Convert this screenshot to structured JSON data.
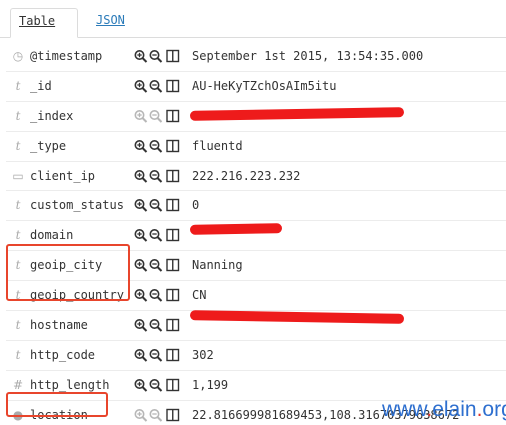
{
  "tabs": {
    "table_label": "Table",
    "json_label": "JSON"
  },
  "rows": [
    {
      "type_icon": "clock-icon",
      "type_glyph": "◷",
      "field": "@timestamp",
      "value": "September 1st 2015, 13:54:35.000"
    },
    {
      "type_icon": "string-type-icon",
      "type_glyph": "t",
      "field": "_id",
      "value": "AU-HeKyTZchOsAIm5itu"
    },
    {
      "type_icon": "string-type-icon",
      "type_glyph": "t",
      "field": "_index",
      "value": ""
    },
    {
      "type_icon": "string-type-icon",
      "type_glyph": "t",
      "field": "_type",
      "value": "fluentd"
    },
    {
      "type_icon": "ip-type-icon",
      "type_glyph": "▭",
      "field": "client_ip",
      "value": "222.216.223.232"
    },
    {
      "type_icon": "string-type-icon",
      "type_glyph": "t",
      "field": "custom_status",
      "value": "0"
    },
    {
      "type_icon": "string-type-icon",
      "type_glyph": "t",
      "field": "domain",
      "value": ""
    },
    {
      "type_icon": "string-type-icon",
      "type_glyph": "t",
      "field": "geoip_city",
      "value": "Nanning"
    },
    {
      "type_icon": "string-type-icon",
      "type_glyph": "t",
      "field": "geoip_country",
      "value": "CN"
    },
    {
      "type_icon": "string-type-icon",
      "type_glyph": "t",
      "field": "hostname",
      "value": ""
    },
    {
      "type_icon": "string-type-icon",
      "type_glyph": "t",
      "field": "http_code",
      "value": "302"
    },
    {
      "type_icon": "number-type-icon",
      "type_glyph": "#",
      "field": "http_length",
      "value": "1,199"
    },
    {
      "type_icon": "geo-point-type-icon",
      "type_glyph": "●",
      "field": "location",
      "value": "22.816699981689453,108.31670379638672"
    }
  ],
  "watermark": {
    "prefix": "www",
    "dot1": ".",
    "middle": "elain",
    "dot2": ".",
    "suffix": "org"
  },
  "colors": {
    "link": "#2b7bb9",
    "highlight": "#e8452c",
    "redaction": "#ee1b1b",
    "watermark": "#2e6fcf"
  }
}
